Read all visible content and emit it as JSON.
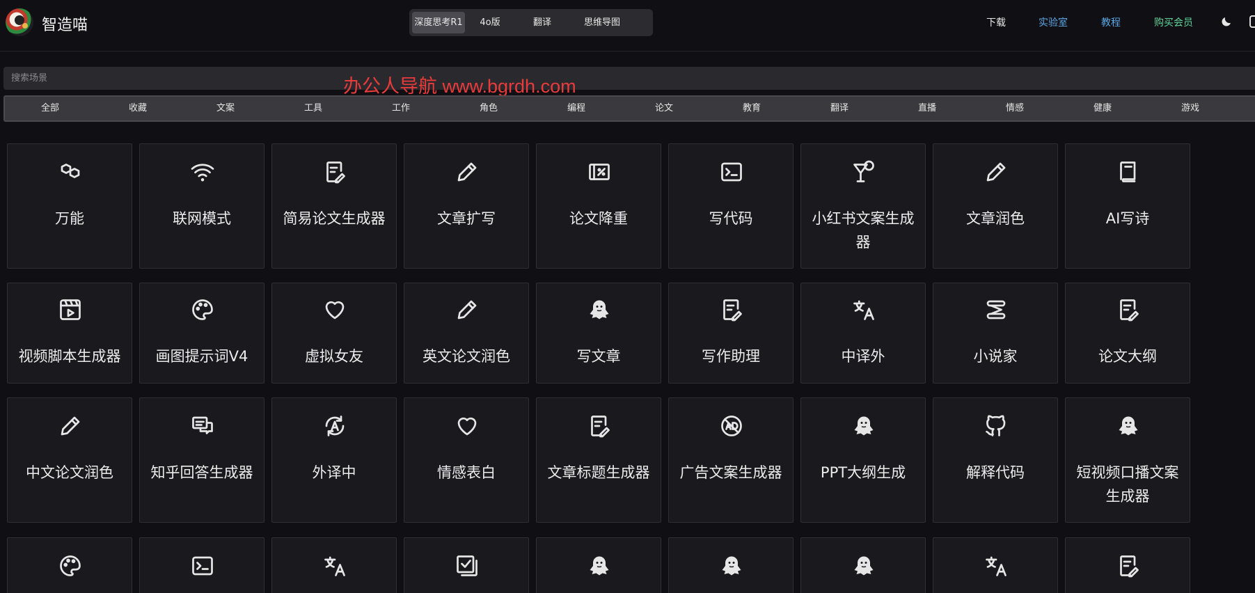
{
  "header": {
    "brand": "智造喵",
    "modes": [
      "深度思考R1",
      "4o版",
      "翻译",
      "思维导图"
    ],
    "nav": {
      "download": "下载",
      "lab": "实验室",
      "tutorial": "教程",
      "member": "购买会员"
    }
  },
  "search": {
    "placeholder": "搜索场景"
  },
  "watermark": "办公人导航 www.bgrdh.com",
  "categories": [
    "全部",
    "收藏",
    "文案",
    "工具",
    "工作",
    "角色",
    "编程",
    "论文",
    "教育",
    "翻译",
    "直播",
    "情感",
    "健康",
    "游戏"
  ],
  "cards": [
    [
      {
        "title": "万能",
        "icon": "hexagons-icon"
      },
      {
        "title": "联网模式",
        "icon": "wifi-icon"
      },
      {
        "title": "简易论文生成器",
        "icon": "document-edit-icon"
      },
      {
        "title": "文章扩写",
        "icon": "pencil-icon"
      },
      {
        "title": "论文降重",
        "icon": "percent-box-icon"
      },
      {
        "title": "写代码",
        "icon": "terminal-icon"
      },
      {
        "title": "小红书文案生成器",
        "icon": "cocktail-icon"
      },
      {
        "title": "文章润色",
        "icon": "pencil-icon"
      },
      {
        "title": "AI写诗",
        "icon": "book-icon"
      }
    ],
    [
      {
        "title": "视频脚本生成器",
        "icon": "video-icon"
      },
      {
        "title": "画图提示词V4",
        "icon": "palette-icon"
      },
      {
        "title": "虚拟女友",
        "icon": "heart-icon"
      },
      {
        "title": "英文论文润色",
        "icon": "pencil-icon"
      },
      {
        "title": "写文章",
        "icon": "ghost-icon"
      },
      {
        "title": "写作助理",
        "icon": "document-edit-icon"
      },
      {
        "title": "中译外",
        "icon": "translate-icon"
      },
      {
        "title": "小说家",
        "icon": "scroll-icon"
      },
      {
        "title": "论文大纲",
        "icon": "document-edit-icon"
      }
    ],
    [
      {
        "title": "中文论文润色",
        "icon": "pencil-icon"
      },
      {
        "title": "知乎回答生成器",
        "icon": "messages-icon"
      },
      {
        "title": "外译中",
        "icon": "circle-a-icon"
      },
      {
        "title": "情感表白",
        "icon": "heart-icon"
      },
      {
        "title": "文章标题生成器",
        "icon": "document-edit-icon"
      },
      {
        "title": "广告文案生成器",
        "icon": "ad-circle-icon"
      },
      {
        "title": "PPT大纲生成",
        "icon": "ghost-icon"
      },
      {
        "title": "解释代码",
        "icon": "github-icon"
      },
      {
        "title": "短视频口播文案生成器",
        "icon": "ghost-icon"
      }
    ],
    [
      {
        "title": "",
        "icon": "palette-icon"
      },
      {
        "title": "",
        "icon": "terminal-icon"
      },
      {
        "title": "",
        "icon": "translate-icon"
      },
      {
        "title": "",
        "icon": "checkbox-icon"
      },
      {
        "title": "",
        "icon": "ghost-icon"
      },
      {
        "title": "",
        "icon": "ghost-icon"
      },
      {
        "title": "",
        "icon": "ghost-icon"
      },
      {
        "title": "",
        "icon": "translate-icon"
      },
      {
        "title": "",
        "icon": "document-edit-icon"
      }
    ]
  ]
}
